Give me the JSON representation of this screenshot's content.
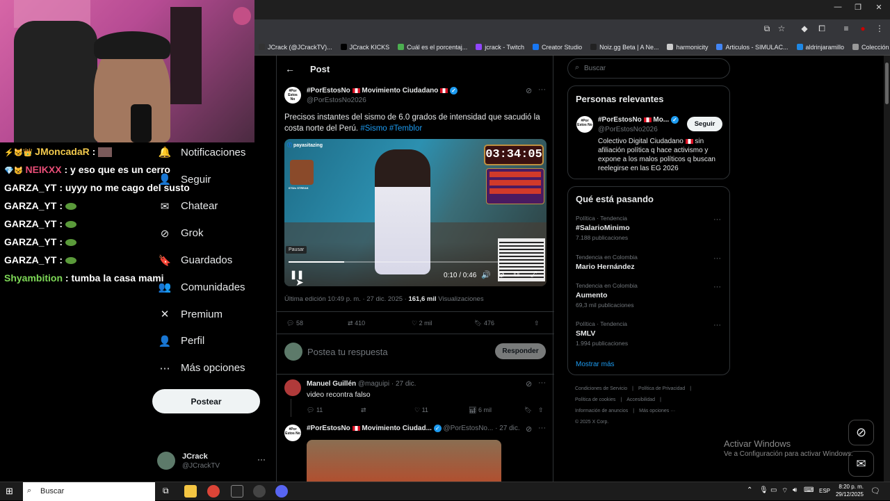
{
  "browser": {
    "bookmarks": [
      {
        "label": "JCrack (@JCrackTV)...",
        "color": "#333"
      },
      {
        "label": "JCrack KICKS",
        "color": "#000"
      },
      {
        "label": "Cuál es el porcentaj...",
        "color": "#4caf50"
      },
      {
        "label": "jcrack - Twitch",
        "color": "#9146ff"
      },
      {
        "label": "Creator Studio",
        "color": "#1877f2"
      },
      {
        "label": "Noiz.gg Beta | A Ne...",
        "color": "#222"
      },
      {
        "label": "harmonicity",
        "color": "#ccc"
      },
      {
        "label": "Articulos - SIMULAC...",
        "color": "#4285f4"
      },
      {
        "label": "aldrinjaramillo",
        "color": "#1e88e5"
      },
      {
        "label": "Colección de M_blei...",
        "color": "#999"
      }
    ]
  },
  "chat": [
    {
      "user": "JMoncadaR",
      "text": "",
      "color": "#f2c94c",
      "emote": "photo",
      "badges": "⚡😺👑"
    },
    {
      "user": "NEIKXX",
      "text": "y eso que es un cerro",
      "color": "#e94e77",
      "emote": "",
      "badges": "💎😺"
    },
    {
      "user": "GARZA_YT",
      "text": "uyyy no me cago del susto",
      "color": "#ffffff",
      "emote": "",
      "badges": ""
    },
    {
      "user": "GARZA_YT",
      "text": "",
      "color": "#ffffff",
      "emote": "pepe",
      "badges": ""
    },
    {
      "user": "GARZA_YT",
      "text": "",
      "color": "#ffffff",
      "emote": "pepe",
      "badges": ""
    },
    {
      "user": "GARZA_YT",
      "text": "",
      "color": "#ffffff",
      "emote": "pepe",
      "badges": ""
    },
    {
      "user": "GARZA_YT",
      "text": "",
      "color": "#ffffff",
      "emote": "pepe",
      "badges": ""
    },
    {
      "user": "Shyambition",
      "text": "tumba la casa mami",
      "color": "#7ed957",
      "emote": "",
      "badges": ""
    }
  ],
  "nav": {
    "items": [
      {
        "label": "Notificaciones",
        "icon": "bell-icon",
        "glyph": "🔔"
      },
      {
        "label": "Seguir",
        "icon": "person-plus-icon",
        "glyph": "👤"
      },
      {
        "label": "Chatear",
        "icon": "mail-icon",
        "glyph": "✉"
      },
      {
        "label": "Grok",
        "icon": "grok-icon",
        "glyph": "⊘"
      },
      {
        "label": "Guardados",
        "icon": "bookmark-icon",
        "glyph": "🔖"
      },
      {
        "label": "Comunidades",
        "icon": "people-icon",
        "glyph": "👥"
      },
      {
        "label": "Premium",
        "icon": "x-logo-icon",
        "glyph": "✕"
      },
      {
        "label": "Perfil",
        "icon": "profile-icon",
        "glyph": "👤"
      },
      {
        "label": "Más opciones",
        "icon": "more-circle-icon",
        "glyph": "⋯"
      }
    ],
    "post_button": "Postear",
    "account_name": "JCrack",
    "account_handle": "@JCrackTV"
  },
  "main": {
    "header_title": "Post",
    "post": {
      "author": "#PorEstosNo",
      "author_suffix": "Movimiento Ciudadano",
      "handle": "@PorEstosNo2026",
      "avatar_text": "#Por Estos No",
      "text": "Precisos instantes del sismo de 6.0 grados de intensidad que sacudió la costa norte del Perú.",
      "hashtags": "#Sismo #Temblor",
      "video": {
        "watermark": "payasitazing",
        "timer": "03:34:05",
        "streak": "6702x STREAK",
        "pause_tooltip": "Pausar",
        "time": "0:10 / 0:46",
        "progress": 0.22
      },
      "meta_edit": "Última edición 10:49 p. m. · 27 dic. 2025 ·",
      "views_count": "161,6 mil",
      "views_label": "Visualizaciones",
      "replies": "58",
      "reposts": "410",
      "likes": "2 mil",
      "bookmarks": "476"
    },
    "reply_placeholder": "Postea tu respuesta",
    "reply_button": "Responder",
    "replies": [
      {
        "name": "Manuel Guillén",
        "handle": "@maguipi · 27 dic.",
        "text": "video recontra falso",
        "replies": "11",
        "likes": "11",
        "views": "6 mil"
      },
      {
        "name": "#PorEstosNo",
        "name_suffix": "Movimiento Ciudad...",
        "handle": "@PorEstosNo... · 27 dic."
      }
    ]
  },
  "right": {
    "search_placeholder": "Buscar",
    "relevant_title": "Personas relevantes",
    "relevant": {
      "name": "#PorEstosNo",
      "name_suffix": "Mo...",
      "handle": "@PorEstosNo2026",
      "follow": "Seguir",
      "bio_pre": "Colectivo Digital Ciudadano",
      "bio_post": "sin afiliación política q hace activismo y expone a los malos políticos q buscan reelegirse en las EG 2026"
    },
    "trending_title": "Qué está pasando",
    "trends": [
      {
        "context": "Política · Tendencia",
        "name": "#SalarioMinimo",
        "count": "7.188 publicaciones"
      },
      {
        "context": "Tendencia en Colombia",
        "name": "Mario Hernández",
        "count": ""
      },
      {
        "context": "Tendencia en Colombia",
        "name": "Aumento",
        "count": "69,3 mil publicaciones"
      },
      {
        "context": "Política · Tendencia",
        "name": "SMLV",
        "count": "1.994 publicaciones"
      }
    ],
    "show_more": "Mostrar más",
    "footer_lines": [
      [
        "Condiciones de Servicio",
        "|",
        "Política de Privacidad",
        "|"
      ],
      [
        "Política de cookies",
        "|",
        "Accesibilidad",
        "|"
      ],
      [
        "Información de anuncios",
        "|",
        "Más opciones ···"
      ],
      [
        "© 2025 X Corp."
      ]
    ]
  },
  "windows": {
    "activate_title": "Activar Windows",
    "activate_sub": "Ve a Configuración para activar Windows.",
    "search_placeholder": "Buscar",
    "lang": "ESP",
    "time": "8:20 p. m.",
    "date": "29/12/2025"
  }
}
